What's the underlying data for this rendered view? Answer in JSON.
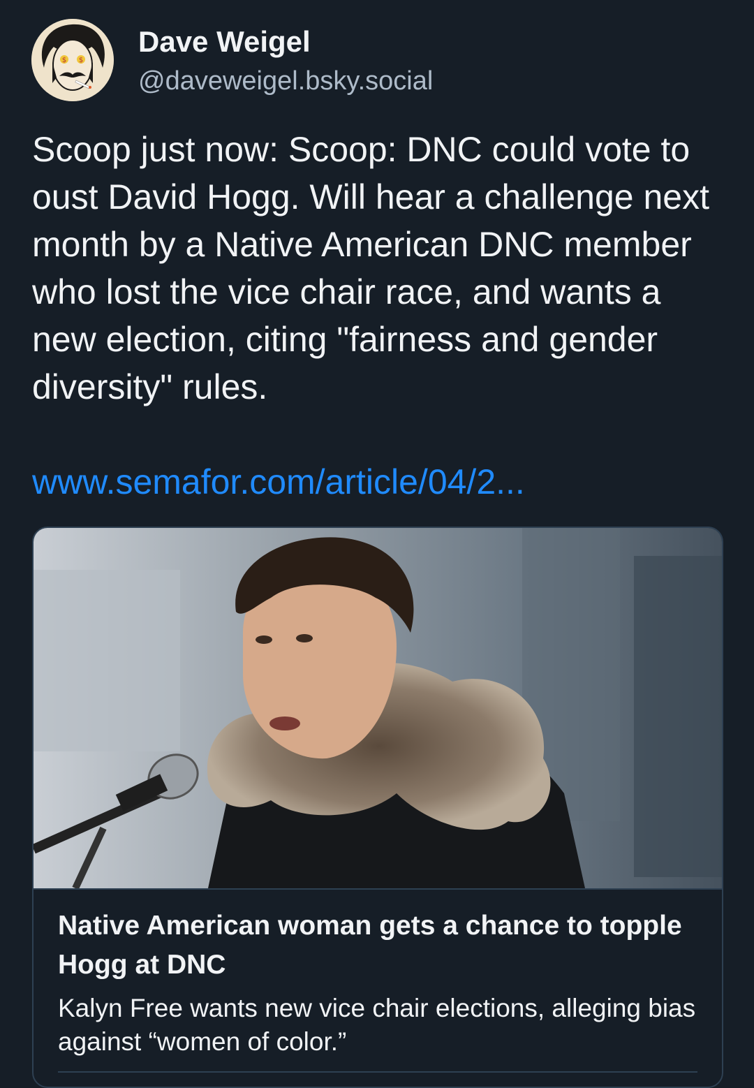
{
  "author": {
    "display_name": "Dave Weigel",
    "handle": "@daveweigel.bsky.social",
    "avatar_icon": "cartoon-avatar-icon"
  },
  "post": {
    "text": "Scoop just now: Scoop: DNC could vote to oust David Hogg. Will hear a challenge next month by a Native American DNC member who lost the vice chair race, and wants a new election, citing \"fairness and gender diversity\" rules.",
    "link_text": "www.semafor.com/article/04/2..."
  },
  "link_card": {
    "title": "Native American woman gets a chance to topple Hogg at DNC",
    "description": "Kalyn Free wants new vice chair elections, alleging bias against “women of color.”"
  },
  "colors": {
    "background": "#161e27",
    "text": "#f1f3f5",
    "handle": "#aebbc9",
    "link": "#208bfe",
    "border": "#2e4052"
  }
}
